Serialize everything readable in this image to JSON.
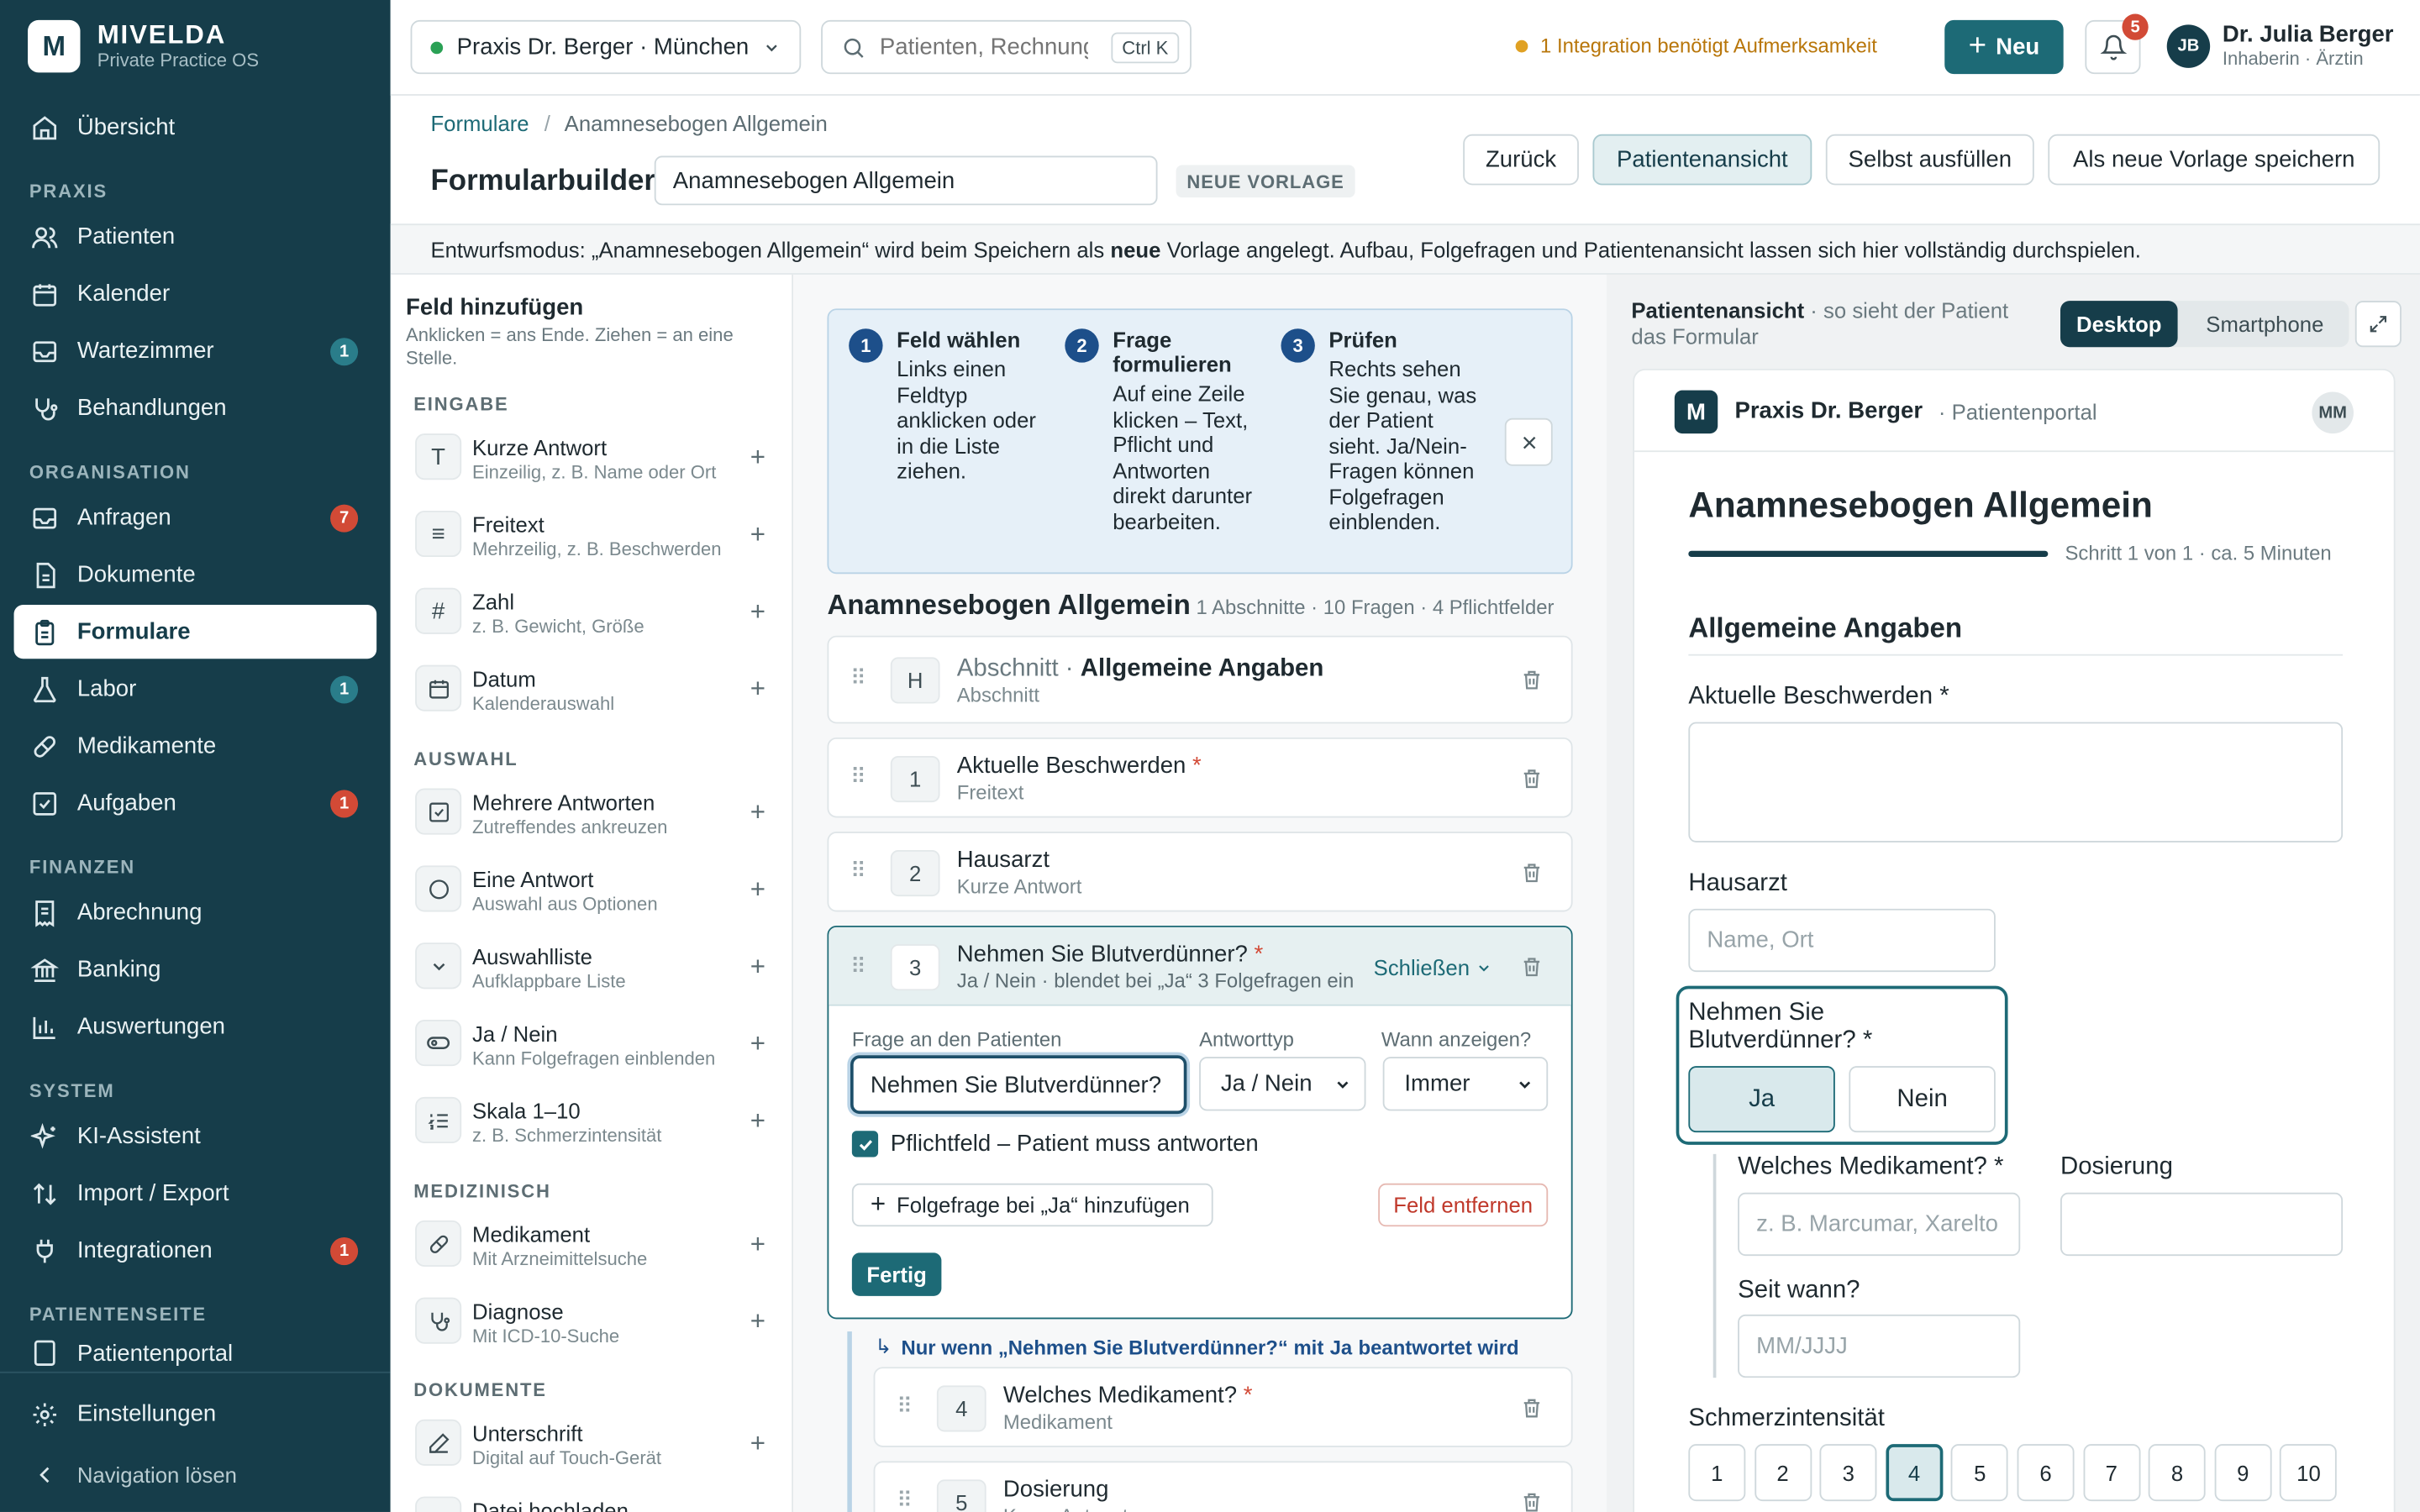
{
  "sidebar": {
    "logo_letter": "M",
    "brand": "MIVELDA",
    "brand_sub": "Private Practice OS",
    "overview": "Übersicht",
    "sections": {
      "praxis": "PRAXIS",
      "organisation": "ORGANISATION",
      "finanzen": "FINANZEN",
      "system": "SYSTEM",
      "patientenseite": "PATIENTENSEITE"
    },
    "items": {
      "patienten": "Patienten",
      "kalender": "Kalender",
      "wartezimmer": "Wartezimmer",
      "wartezimmer_badge": "1",
      "behandlungen": "Behandlungen",
      "anfragen": "Anfragen",
      "anfragen_badge": "7",
      "dokumente": "Dokumente",
      "formulare": "Formulare",
      "labor": "Labor",
      "labor_badge": "1",
      "medikamente": "Medikamente",
      "aufgaben": "Aufgaben",
      "aufgaben_badge": "1",
      "abrechnung": "Abrechnung",
      "banking": "Banking",
      "auswertungen": "Auswertungen",
      "ki": "KI-Assistent",
      "import": "Import / Export",
      "integrationen": "Integrationen",
      "integrationen_badge": "1",
      "patientenportal": "Patientenportal",
      "einstellungen": "Einstellungen",
      "navigation_loesen": "Navigation lösen"
    }
  },
  "topbar": {
    "practice": "Praxis Dr. Berger · München",
    "search_placeholder": "Patienten, Rechnungen",
    "search_shortcut": "Ctrl K",
    "alert": "1 Integration benötigt Aufmerksamkeit",
    "new_button": "Neu",
    "bell_badge": "5",
    "avatar": "JB",
    "user_name": "Dr. Julia Berger",
    "user_role": "Inhaberin · Ärztin"
  },
  "header": {
    "breadcrumb_root": "Formulare",
    "breadcrumb_sep": "/",
    "breadcrumb_current": "Anamnesebogen Allgemein",
    "title": "Formularbuilder",
    "form_name": "Anamnesebogen Allgemein",
    "badge": "NEUE VORLAGE",
    "btn_back": "Zurück",
    "btn_patient_view": "Patientenansicht",
    "btn_self_fill": "Selbst ausfüllen",
    "btn_save_template": "Als neue Vorlage speichern"
  },
  "draft_banner": {
    "prefix": "Entwurfsmodus: „Anamnesebogen Allgemein“ wird beim Speichern als ",
    "bold": "neue",
    "suffix": " Vorlage angelegt. Aufbau, Folgefragen und Patientenansicht lassen sich hier vollständig durchspielen."
  },
  "field_panel": {
    "title": "Feld hinzufügen",
    "subtitle": "Anklicken = ans Ende. Ziehen = an eine Stelle.",
    "sec_eingabe": "EINGABE",
    "sec_auswahl": "AUSWAHL",
    "sec_medizinisch": "MEDIZINISCH",
    "sec_dokumente": "DOKUMENTE",
    "fields": [
      {
        "title": "Kurze Antwort",
        "sub": "Einzeilig, z. B. Name oder Ort"
      },
      {
        "title": "Freitext",
        "sub": "Mehrzeilig, z. B. Beschwerden"
      },
      {
        "title": "Zahl",
        "sub": "z. B. Gewicht, Größe"
      },
      {
        "title": "Datum",
        "sub": "Kalenderauswahl"
      },
      {
        "title": "Mehrere Antworten",
        "sub": "Zutreffendes ankreuzen"
      },
      {
        "title": "Eine Antwort",
        "sub": "Auswahl aus Optionen"
      },
      {
        "title": "Auswahlliste",
        "sub": "Aufklappbare Liste"
      },
      {
        "title": "Ja / Nein",
        "sub": "Kann Folgefragen einblenden"
      },
      {
        "title": "Skala 1–10",
        "sub": "z. B. Schmerzintensität"
      },
      {
        "title": "Medikament",
        "sub": "Mit Arzneimittelsuche"
      },
      {
        "title": "Diagnose",
        "sub": "Mit ICD-10-Suche"
      },
      {
        "title": "Unterschrift",
        "sub": "Digital auf Touch-Gerät"
      },
      {
        "title": "Datei hochladen",
        "sub": ""
      }
    ]
  },
  "steps": [
    {
      "num": "1",
      "title": "Feld wählen",
      "text": "Links einen Feldtyp anklicken oder in die Liste ziehen."
    },
    {
      "num": "2",
      "title": "Frage formulieren",
      "text": "Auf eine Zeile klicken – Text, Pflicht und Antworten direkt darunter bearbeiten."
    },
    {
      "num": "3",
      "title": "Prüfen",
      "text": "Rechts sehen Sie genau, was der Patient sieht. Ja/Nein-Fragen können Folgefragen einblenden."
    }
  ],
  "form": {
    "title": "Anamnesebogen Allgemein",
    "meta": "1 Abschnitte · 10 Fragen · 4 Pflichtfelder",
    "section_prefix": "Abschnitt · ",
    "section_name": "Allgemeine Angaben",
    "section_type": "Abschnitt",
    "section_letter": "H",
    "questions": [
      {
        "num": "1",
        "title": "Aktuelle Beschwerden",
        "type": "Freitext"
      },
      {
        "num": "2",
        "title": "Hausarzt",
        "type": "Kurze Antwort"
      },
      {
        "num": "3",
        "title": "Nehmen Sie Blutverdünner?",
        "type": "Ja / Nein · blendet bei „Ja“ 3 Folgefragen ein"
      },
      {
        "num": "4",
        "title": "Welches Medikament?",
        "type": "Medikament"
      },
      {
        "num": "5",
        "title": "Dosierung",
        "type": "Kurze Antwort"
      }
    ],
    "close_label": "Schließen",
    "editor": {
      "label_question": "Frage an den Patienten",
      "label_type": "Antworttyp",
      "label_when": "Wann anzeigen?",
      "question_value": "Nehmen Sie Blutverdünner?",
      "type_value": "Ja / Nein",
      "when_value": "Immer",
      "required_label": "Pflichtfeld – Patient muss antworten",
      "add_followup": "Folgefrage bei „Ja“ hinzufügen",
      "remove_field": "Feld entfernen",
      "done": "Fertig"
    },
    "condition_prefix": "Nur wenn „Nehmen Sie Blutverdünner?“ mit ",
    "condition_value": "Ja",
    "condition_suffix": " beantwortet wird"
  },
  "preview": {
    "title": "Patientenansicht",
    "subtitle": " · so sieht der Patient das Formular",
    "tab_desktop": "Desktop",
    "tab_phone": "Smartphone",
    "portal_logo": "M",
    "portal_name": "Praxis Dr. Berger",
    "portal_sub": "· Patientenportal",
    "portal_avatar": "MM",
    "form_title": "Anamnesebogen Allgemein",
    "progress_text": "Schritt 1 von 1 · ca. 5 Minuten",
    "progress": 1.0,
    "section": "Allgemeine Angaben",
    "q_beschwerden": "Aktuelle Beschwerden *",
    "q_hausarzt": "Hausarzt",
    "hausarzt_placeholder": "Name, Ort",
    "q_blut": "Nehmen Sie Blutverdünner? *",
    "yes": "Ja",
    "no": "Nein",
    "q_medikament": "Welches Medikament? *",
    "medikament_placeholder": "z. B. Marcumar, Xarelto",
    "q_dosierung": "Dosierung",
    "q_seit": "Seit wann?",
    "seit_placeholder": "MM/JJJJ",
    "q_schmerz": "Schmerzintensität",
    "scale": [
      "1",
      "2",
      "3",
      "4",
      "5",
      "6",
      "7",
      "8",
      "9",
      "10"
    ],
    "scale_selected": "4"
  },
  "colors": {
    "sidebar": "#163d4a",
    "accent": "#1d6a76",
    "alert": "#b8760a",
    "badge_red": "#d24a36"
  }
}
